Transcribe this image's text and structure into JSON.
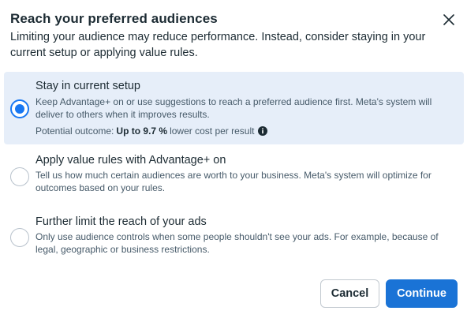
{
  "dialog": {
    "title": "Reach your preferred audiences",
    "subtitle": "Limiting your audience may reduce performance. Instead, consider staying in your current setup or applying value rules.",
    "close_icon": "close-icon"
  },
  "options": [
    {
      "title": "Stay in current setup",
      "description": "Keep Advantage+ on or use suggestions to reach a preferred audience first. Meta's system will deliver to others when it improves results.",
      "selected": true,
      "outcome": {
        "prefix": "Potential outcome:",
        "highlight": "Up to 9.7 %",
        "suffix": "lower cost per result",
        "icon": "info-icon"
      }
    },
    {
      "title": "Apply value rules with Advantage+ on",
      "description": "Tell us how much certain audiences are worth to your business. Meta's system will optimize for outcomes based on your rules.",
      "selected": false
    },
    {
      "title": "Further limit the reach of your ads",
      "description": "Only use audience controls when some people shouldn't see your ads. For example, because of legal, geographic or business restrictions.",
      "selected": false
    }
  ],
  "buttons": {
    "cancel": "Cancel",
    "continue": "Continue"
  },
  "colors": {
    "accent": "#1877f2",
    "selected_bg": "#e6eef9",
    "primary_button": "#1a73d6"
  }
}
